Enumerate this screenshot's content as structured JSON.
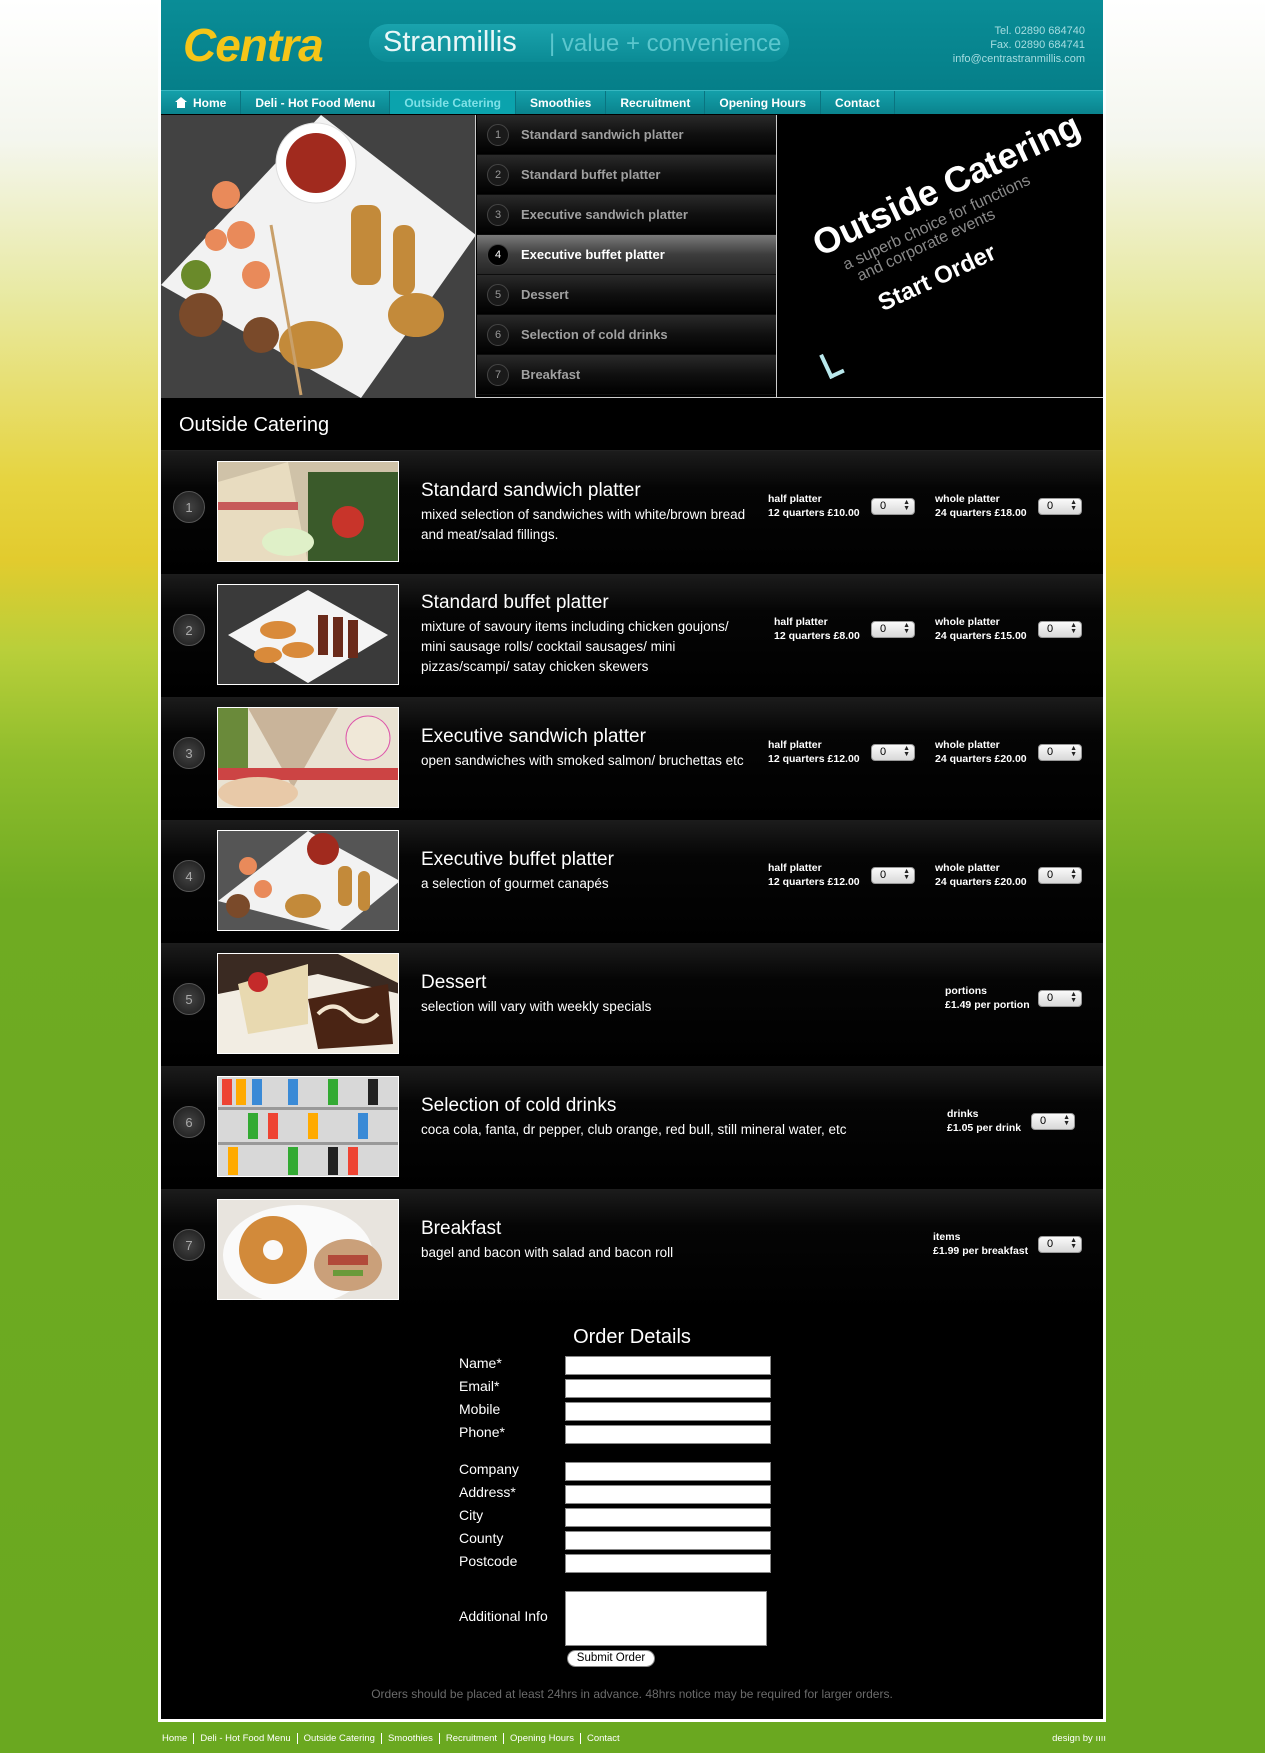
{
  "header": {
    "logo": "Centra",
    "store_name": "Stranmillis",
    "tagline": "| value + convenience",
    "tel": "Tel. 02890 684740",
    "fax": "Fax. 02890 684741",
    "email": "info@centrastranmillis.com"
  },
  "nav": [
    {
      "label": "Home",
      "icon": "home-icon"
    },
    {
      "label": "Deli - Hot Food Menu"
    },
    {
      "label": "Outside Catering",
      "active": true
    },
    {
      "label": "Smoothies"
    },
    {
      "label": "Recruitment"
    },
    {
      "label": "Opening Hours"
    },
    {
      "label": "Contact"
    }
  ],
  "banner_menu": [
    {
      "num": "1",
      "label": "Standard sandwich platter"
    },
    {
      "num": "2",
      "label": "Standard buffet platter"
    },
    {
      "num": "3",
      "label": "Executive sandwich platter"
    },
    {
      "num": "4",
      "label": "Executive buffet platter",
      "active": true
    },
    {
      "num": "5",
      "label": "Dessert"
    },
    {
      "num": "6",
      "label": "Selection of cold drinks"
    },
    {
      "num": "7",
      "label": "Breakfast"
    }
  ],
  "promo": {
    "title": "Outside Catering",
    "subtitle_line1": "a superb choice for functions",
    "subtitle_line2": "and corporate events",
    "cta": "Start Order"
  },
  "section_title": "Outside Catering",
  "products": [
    {
      "num": "1",
      "title": "Standard sandwich platter",
      "desc": "mixed selection of sandwiches with white/brown bread and meat/salad fillings.",
      "options": [
        {
          "name": "half platter",
          "detail": "12 quarters £10.00",
          "qty": "0"
        },
        {
          "name": "whole platter",
          "detail": "24 quarters £18.00",
          "qty": "0"
        }
      ]
    },
    {
      "num": "2",
      "title": "Standard buffet platter",
      "desc": "mixture of savoury items including chicken goujons/ mini sausage rolls/ cocktail sausages/ mini pizzas/scampi/ satay chicken skewers",
      "options": [
        {
          "name": "half platter",
          "detail": "12 quarters £8.00",
          "qty": "0"
        },
        {
          "name": "whole platter",
          "detail": "24 quarters £15.00",
          "qty": "0"
        }
      ]
    },
    {
      "num": "3",
      "title": "Executive sandwich platter",
      "desc": "open sandwiches with smoked salmon/ bruchettas etc",
      "options": [
        {
          "name": "half platter",
          "detail": "12 quarters £12.00",
          "qty": "0"
        },
        {
          "name": "whole platter",
          "detail": "24 quarters £20.00",
          "qty": "0"
        }
      ]
    },
    {
      "num": "4",
      "title": "Executive buffet platter",
      "desc": "a selection of gourmet canapés",
      "options": [
        {
          "name": "half platter",
          "detail": "12 quarters £12.00",
          "qty": "0"
        },
        {
          "name": "whole platter",
          "detail": "24 quarters £20.00",
          "qty": "0"
        }
      ]
    },
    {
      "num": "5",
      "title": "Dessert",
      "desc": "selection will vary with weekly specials",
      "options": [
        {
          "name": "portions",
          "detail": "£1.49 per portion",
          "qty": "0"
        }
      ]
    },
    {
      "num": "6",
      "title": "Selection of cold drinks",
      "desc": "coca cola, fanta, dr pepper, club orange, red bull, still mineral water, etc",
      "options": [
        {
          "name": "drinks",
          "detail": "£1.05 per drink",
          "qty": "0"
        }
      ]
    },
    {
      "num": "7",
      "title": "Breakfast",
      "desc": "bagel and bacon with salad and bacon roll",
      "options": [
        {
          "name": "items",
          "detail": "£1.99 per breakfast",
          "qty": "0"
        }
      ]
    }
  ],
  "form": {
    "title": "Order Details",
    "fields": [
      "Name*",
      "Email*",
      "Mobile",
      "Phone*",
      "Company",
      "Address*",
      "City",
      "County",
      "Postcode"
    ],
    "additional_label": "Additional Info",
    "submit": "Submit Order",
    "notice": "Orders should be placed at least 24hrs in advance. 48hrs notice may be required for larger orders."
  },
  "footer": {
    "links": [
      "Home",
      "Deli - Hot Food Menu",
      "Outside Catering",
      "Smoothies",
      "Recruitment",
      "Opening Hours",
      "Contact"
    ],
    "credit": "design by"
  },
  "colors": {
    "brand_teal": "#0a8d97",
    "logo_yellow": "#f5c518",
    "background_green": "#6aa820"
  }
}
